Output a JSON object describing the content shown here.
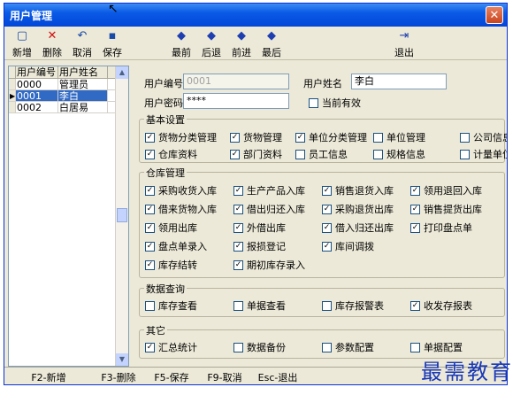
{
  "window": {
    "title": "用户管理",
    "close_label": "✕"
  },
  "toolbar": {
    "new": {
      "icon": "▢",
      "label": "新增"
    },
    "delete": {
      "icon": "✕",
      "label": "删除"
    },
    "cancel": {
      "icon": "↶",
      "label": "取消"
    },
    "save": {
      "icon": "▪",
      "label": "保存"
    },
    "first": {
      "icon": "◆",
      "label": "最前"
    },
    "prev": {
      "icon": "◆",
      "label": "后退"
    },
    "next": {
      "icon": "◆",
      "label": "前进"
    },
    "last": {
      "icon": "◆",
      "label": "最后"
    },
    "exit": {
      "icon": "⇥",
      "label": "退出"
    }
  },
  "grid": {
    "headers": [
      "用户编号",
      "用户姓名"
    ],
    "rows": [
      {
        "code": "0000",
        "name": "管理员"
      },
      {
        "code": "0001",
        "name": "李白",
        "selected": true
      },
      {
        "code": "0002",
        "name": "白居易"
      }
    ],
    "row_marker": "▶"
  },
  "form": {
    "user_code_label": "用户编号",
    "user_code_value": "0001",
    "user_name_label": "用户姓名",
    "user_name_value": "李白",
    "password_label": "用户密码",
    "password_value": "****",
    "active_label": "当前有效",
    "active_checked": false
  },
  "groups": {
    "basic": {
      "title": "基本设置",
      "items": [
        {
          "label": "货物分类管理",
          "checked": true
        },
        {
          "label": "货物管理",
          "checked": true
        },
        {
          "label": "单位分类管理",
          "checked": true
        },
        {
          "label": "单位管理",
          "checked": false
        },
        {
          "label": "公司信息",
          "checked": false
        },
        {
          "label": "仓库资料",
          "checked": true
        },
        {
          "label": "部门资料",
          "checked": true
        },
        {
          "label": "员工信息",
          "checked": false
        },
        {
          "label": "规格信息",
          "checked": false
        },
        {
          "label": "计量单位",
          "checked": false
        }
      ]
    },
    "warehouse": {
      "title": "仓库管理",
      "items": [
        {
          "label": "采购收货入库",
          "checked": true
        },
        {
          "label": "生产产品入库",
          "checked": true
        },
        {
          "label": "销售退货入库",
          "checked": true
        },
        {
          "label": "领用退回入库",
          "checked": true
        },
        {
          "label": "借来货物入库",
          "checked": true
        },
        {
          "label": "借出归还入库",
          "checked": true
        },
        {
          "label": "采购退货出库",
          "checked": true
        },
        {
          "label": "销售提货出库",
          "checked": true
        },
        {
          "label": "领用出库",
          "checked": true
        },
        {
          "label": "外借出库",
          "checked": true
        },
        {
          "label": "借入归还出库",
          "checked": true
        },
        {
          "label": "打印盘点单",
          "checked": true
        },
        {
          "label": "盘点单录入",
          "checked": true
        },
        {
          "label": "报损登记",
          "checked": true
        },
        {
          "label": "库间调拨",
          "checked": true
        },
        {
          "label": "库存结转",
          "checked": true
        },
        {
          "label": "期初库存录入",
          "checked": true
        }
      ]
    },
    "query": {
      "title": "数据查询",
      "items": [
        {
          "label": "库存查看",
          "checked": false
        },
        {
          "label": "单据查看",
          "checked": false
        },
        {
          "label": "库存报警表",
          "checked": false
        },
        {
          "label": "收发存报表",
          "checked": true
        }
      ]
    },
    "other": {
      "title": "其它",
      "items": [
        {
          "label": "汇总统计",
          "checked": true
        },
        {
          "label": "数据备份",
          "checked": false
        },
        {
          "label": "参数配置",
          "checked": false
        },
        {
          "label": "单据配置",
          "checked": false
        }
      ]
    }
  },
  "status": [
    "F2-新增",
    "F3-删除",
    "F5-保存",
    "F9-取消",
    "Esc-退出"
  ],
  "watermark": "最需教育",
  "colors": {
    "titlebar": "#0a5ae6",
    "selection": "#316ac5",
    "window_bg": "#ece9d8"
  }
}
